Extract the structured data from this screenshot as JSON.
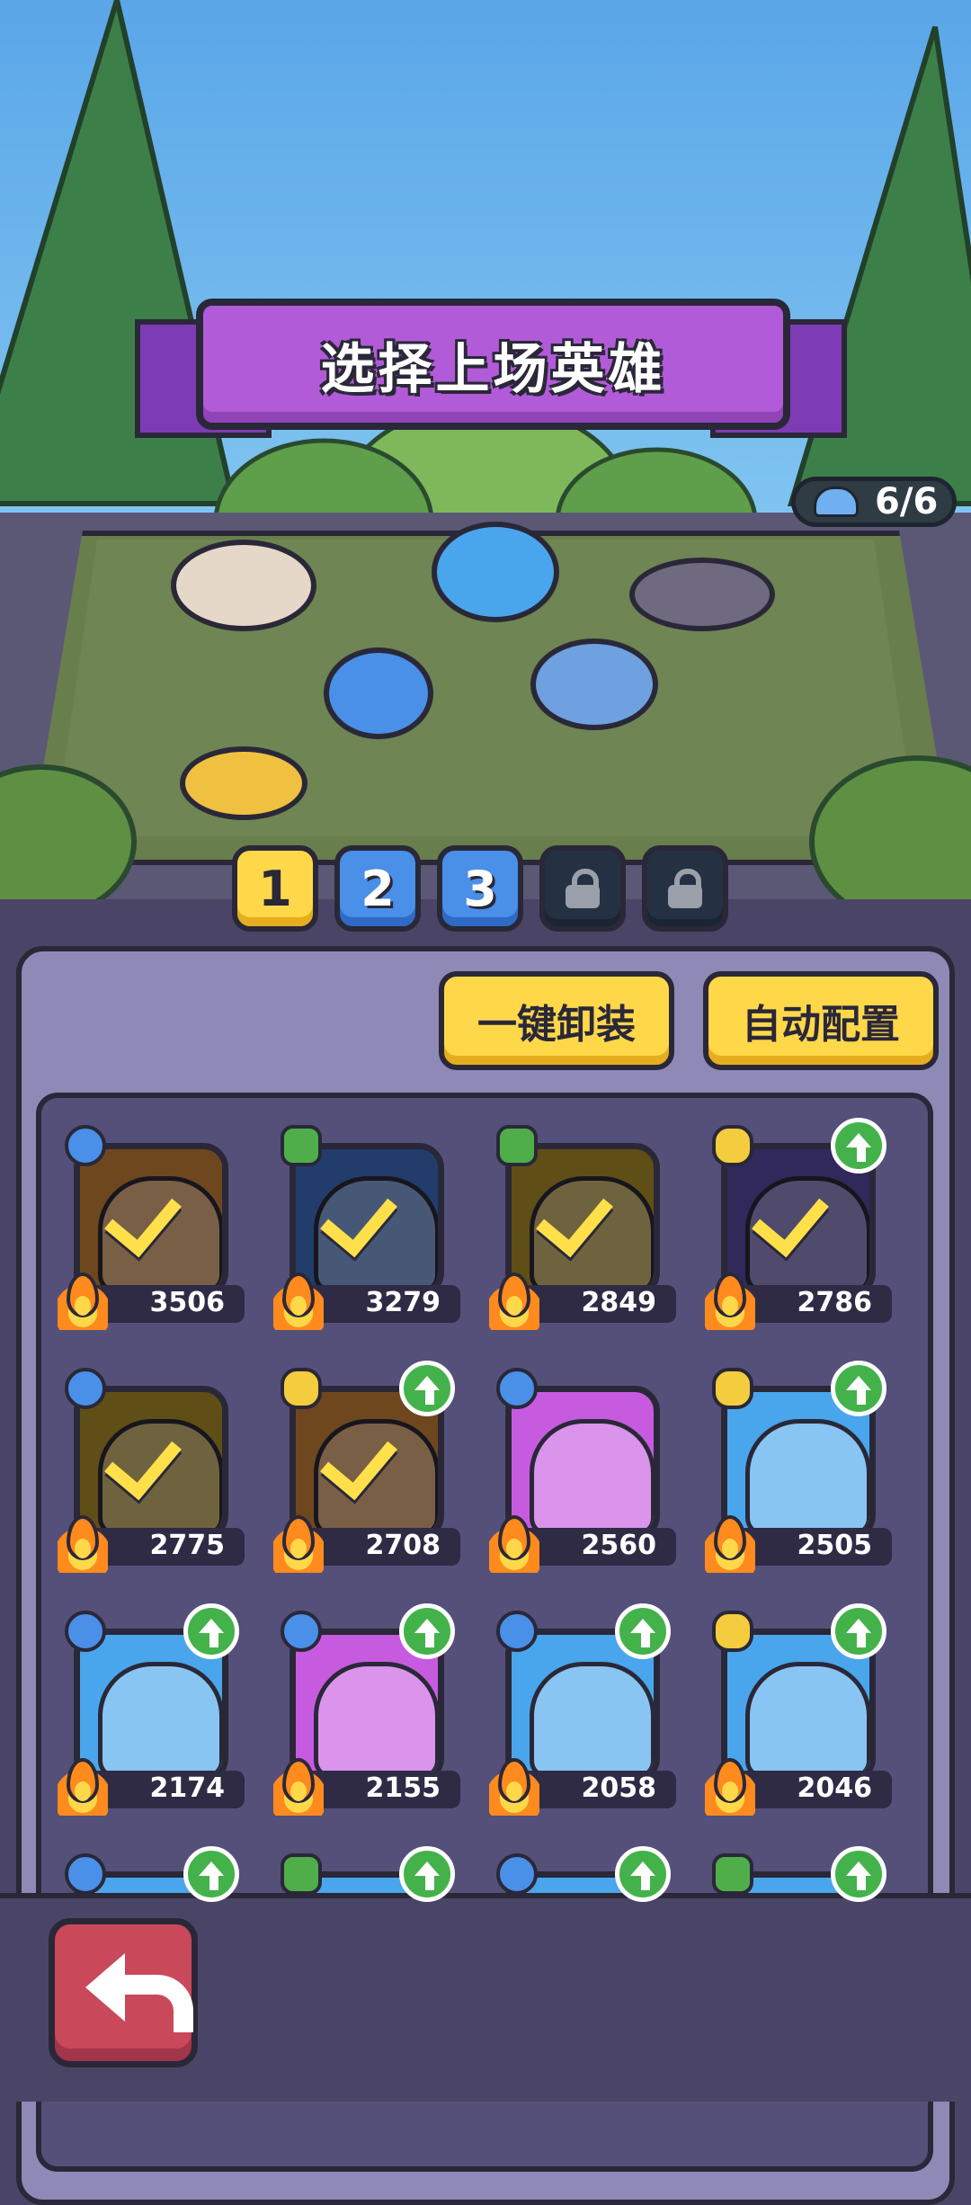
{
  "header": {
    "title": "选择上场英雄",
    "hero_count": "6/6"
  },
  "team_tabs": [
    {
      "label": "1",
      "state": "active"
    },
    {
      "label": "2",
      "state": "available"
    },
    {
      "label": "3",
      "state": "available"
    },
    {
      "label": "",
      "state": "locked"
    },
    {
      "label": "",
      "state": "locked"
    }
  ],
  "actions": {
    "unequip_all": "一键卸装",
    "auto_config": "自动配置"
  },
  "heroes": [
    {
      "power": "3506",
      "class": "sword",
      "selected": true,
      "upgrade": false,
      "color": "#c9823a"
    },
    {
      "power": "3279",
      "class": "gear",
      "selected": true,
      "upgrade": false,
      "color": "#3f6fc4"
    },
    {
      "power": "2849",
      "class": "gear",
      "selected": true,
      "upgrade": false,
      "color": "#b08e2a"
    },
    {
      "power": "2786",
      "class": "skull",
      "selected": true,
      "upgrade": true,
      "color": "#5a4aa8"
    },
    {
      "power": "2775",
      "class": "sword",
      "selected": true,
      "upgrade": false,
      "color": "#b08e2a"
    },
    {
      "power": "2708",
      "class": "skull",
      "selected": true,
      "upgrade": true,
      "color": "#c9823a"
    },
    {
      "power": "2560",
      "class": "sword",
      "selected": false,
      "upgrade": false,
      "color": "#c65be0"
    },
    {
      "power": "2505",
      "class": "skull",
      "selected": false,
      "upgrade": true,
      "color": "#4aa6ec"
    },
    {
      "power": "2174",
      "class": "sword",
      "selected": false,
      "upgrade": true,
      "color": "#4aa6ec"
    },
    {
      "power": "2155",
      "class": "sword",
      "selected": false,
      "upgrade": true,
      "color": "#c65be0"
    },
    {
      "power": "2058",
      "class": "sword",
      "selected": false,
      "upgrade": true,
      "color": "#4aa6ec"
    },
    {
      "power": "2046",
      "class": "skull",
      "selected": false,
      "upgrade": true,
      "color": "#4aa6ec"
    },
    {
      "power": "",
      "class": "sword",
      "selected": false,
      "upgrade": true,
      "color": "#4aa6ec"
    },
    {
      "power": "",
      "class": "gear",
      "selected": false,
      "upgrade": true,
      "color": "#4aa6ec"
    },
    {
      "power": "",
      "class": "sword",
      "selected": false,
      "upgrade": true,
      "color": "#4aa6ec"
    },
    {
      "power": "",
      "class": "gear",
      "selected": false,
      "upgrade": true,
      "color": "#4aa6ec"
    }
  ],
  "icons": {
    "back": "back-arrow-icon",
    "lock": "lock-icon",
    "flame": "flame-icon",
    "upgrade": "up-arrow-icon"
  }
}
